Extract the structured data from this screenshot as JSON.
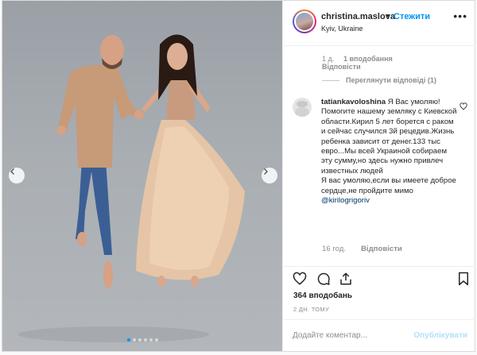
{
  "post": {
    "username": "christina.maslova",
    "separator": "•",
    "follow_label": "Стежити",
    "location": "Kyiv, Ukraine",
    "more_label": "•••",
    "carousel_dots": 6,
    "active_dot": 0
  },
  "comments": {
    "prev": {
      "time": "1 д.",
      "likes": "1 вподобання",
      "reply_label": "Відповісти",
      "view_replies": "Переглянути відповіді (1)"
    },
    "main": {
      "username": "tatiankavoloshina",
      "text": "Я Вас умоляю! Помогите нашему земляку с Киевской области.Кирил 5 лет борется с раком и сейчас случился 3й рецедив.Жизнь ребенка зависит от денег.133 тыс евро...Мы всей Украиной собираем эту сумму,но здесь нужно привлеч известных людей",
      "text2": "Я вас умоляю,если вы имеете доброе сердце,не пройдите мимо ",
      "mention": "@kirilogrigoriv",
      "time": "16 год.",
      "reply_label": "Відповісти"
    }
  },
  "footer": {
    "likes": "364 вподобань",
    "date": "2 ДН. ТОМУ",
    "add_placeholder": "Додайте коментар...",
    "publish_label": "Опублікувати"
  },
  "icons": {
    "like": "heart-icon",
    "comment": "comment-icon",
    "share": "share-icon",
    "save": "bookmark-icon"
  },
  "colors": {
    "accent": "#0095f6",
    "publish_disabled": "#b2dffc",
    "muted": "#8e8e8e"
  }
}
